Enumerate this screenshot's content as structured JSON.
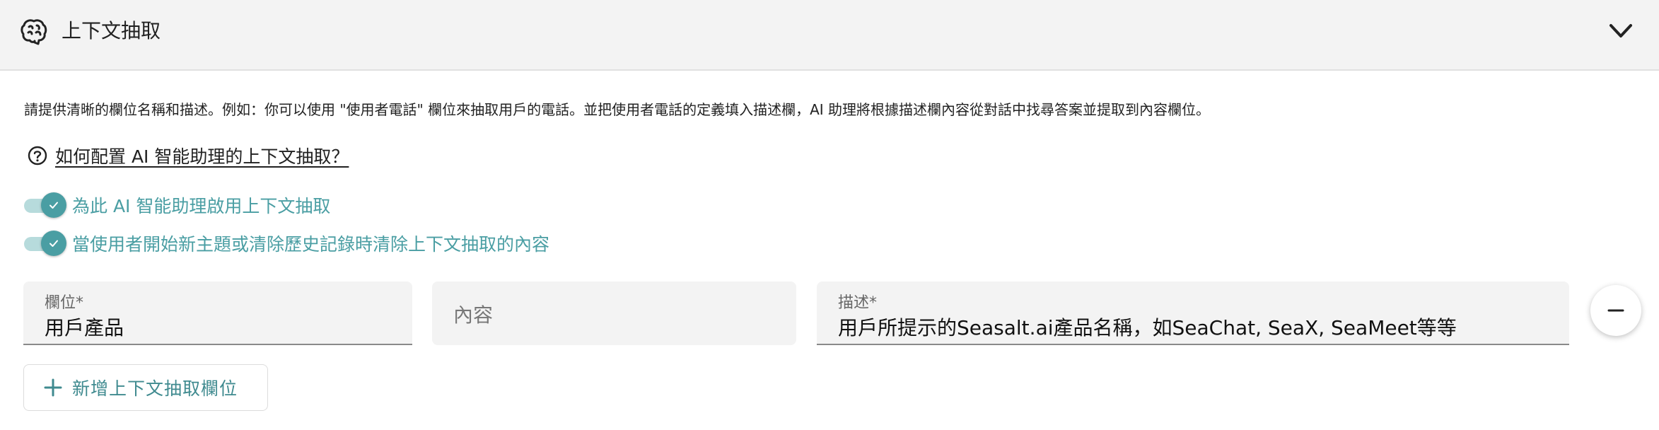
{
  "header": {
    "title": "上下文抽取",
    "icon": "brain-icon",
    "collapse_icon": "chevron-down-icon"
  },
  "description": "請提供清晰的欄位名稱和描述。例如：你可以使用 \"使用者電話\" 欄位來抽取用戶的電話。並把使用者電話的定義填入描述欄，AI 助理將根據描述欄內容從對話中找尋答案並提取到內容欄位。",
  "help_link": "如何配置 AI 智能助理的上下文抽取？",
  "toggles": [
    {
      "label": "為此 AI 智能助理啟用上下文抽取",
      "checked": true
    },
    {
      "label": "當使用者開始新主題或清除歷史記錄時清除上下文抽取的內容",
      "checked": true
    }
  ],
  "fields": {
    "field_name": {
      "label": "欄位",
      "required": "*",
      "value": "用戶產品"
    },
    "content": {
      "placeholder": "內容"
    },
    "description": {
      "label": "描述",
      "required": "*",
      "value": "用戶所提示的Seasalt.ai產品名稱，如SeaChat, SeaX, SeaMeet等等"
    }
  },
  "add_button": {
    "label": "新增上下文抽取欄位"
  },
  "colors": {
    "accent": "#4a9ea3",
    "header_bg": "#f3f3f3",
    "field_bg": "#f3f3f3"
  }
}
